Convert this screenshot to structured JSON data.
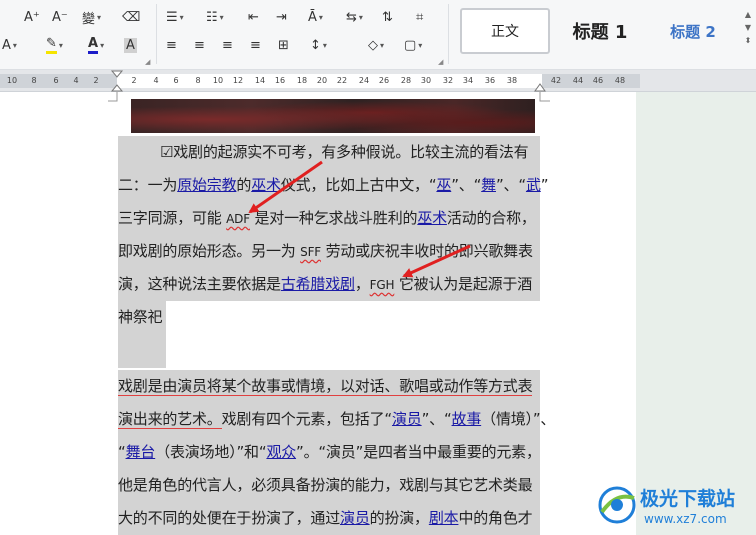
{
  "ribbon": {
    "row1": [
      {
        "name": "font-size-increase-button",
        "glyph": "A⁺"
      },
      {
        "name": "font-size-decrease-button",
        "glyph": "A⁻"
      },
      {
        "name": "phonetic-guide-button",
        "glyph": "變"
      },
      {
        "name": "clear-format-button",
        "glyph": "⌫"
      },
      {
        "name": "bullets-button",
        "glyph": "☰"
      },
      {
        "name": "numbering-button",
        "glyph": "☷"
      },
      {
        "name": "decrease-indent-button",
        "glyph": "⇤"
      },
      {
        "name": "increase-indent-button",
        "glyph": "⇥"
      },
      {
        "name": "text-direction-button",
        "glyph": "Ā"
      },
      {
        "name": "line-direction-button",
        "glyph": "⇆"
      },
      {
        "name": "sort-button",
        "glyph": "⇅"
      },
      {
        "name": "show-marks-button",
        "glyph": "⌗"
      }
    ],
    "row2": [
      {
        "name": "text-effect-button",
        "glyph": "A"
      },
      {
        "name": "highlight-color-button",
        "glyph": "✎"
      },
      {
        "name": "font-color-button",
        "glyph": "A"
      },
      {
        "name": "char-shading-button",
        "glyph": "A"
      },
      {
        "name": "align-left-button",
        "glyph": "≡"
      },
      {
        "name": "align-center-button",
        "glyph": "≡"
      },
      {
        "name": "align-right-button",
        "glyph": "≡"
      },
      {
        "name": "justify-button",
        "glyph": "≡"
      },
      {
        "name": "distributed-button",
        "glyph": "⊞"
      },
      {
        "name": "line-spacing-button",
        "glyph": "↕"
      },
      {
        "name": "shading-button",
        "glyph": "◇"
      },
      {
        "name": "borders-button",
        "glyph": "▢"
      }
    ],
    "colors": {
      "highlight": "#f5e400",
      "font_color": "#1c1cc8",
      "accent": "#3d74c6"
    }
  },
  "styles": {
    "normal": "正文",
    "heading1": "标题 1",
    "heading2": "标题 2",
    "more_up": "▲",
    "more_down": "▼",
    "expand": "⬍"
  },
  "ruler": {
    "labels": [
      "10",
      "8",
      "6",
      "4",
      "2",
      "2",
      "4",
      "6",
      "8",
      "10",
      "12",
      "14",
      "16",
      "18",
      "20",
      "22",
      "24",
      "26",
      "28",
      "30",
      "32",
      "34",
      "36",
      "38",
      "42",
      "44",
      "46",
      "48"
    ]
  },
  "document": {
    "p1": {
      "l1": [
        "☑戏剧的起源实不可考，有多种假说。比较主流的看法有"
      ],
      "l2": [
        "二：一为",
        "原始宗教",
        "的",
        "巫术",
        "仪式，比如上古中文，“",
        "巫",
        "”、“",
        "舞",
        "”、“",
        "武",
        "”"
      ],
      "l3": [
        "三字同源，可能 ",
        "ADF",
        " 是对一种乞求战斗胜利的",
        "巫术",
        "活动的合称，"
      ],
      "l4": [
        "即戏剧的原始形态。另一为 ",
        "SFF",
        " 劳动或庆祝丰收时的即兴歌舞表"
      ],
      "l5": [
        "演，这种说法主要依据是",
        "古希腊戏剧",
        "，",
        "FGH",
        " 它被认为是起源于酒"
      ],
      "l6": [
        "神祭祀"
      ]
    },
    "p2": {
      "l1": [
        "戏剧是由演员将某个故事或情境，以对话、歌唱或动作等方式表"
      ],
      "l2": [
        "演出来的艺术。",
        "戏剧有四个元素，包括了“",
        "演员",
        "”、“",
        "故事",
        "（情境）”、"
      ],
      "l3": [
        "“",
        "舞台",
        "（表演场地）”和“",
        "观众",
        "”。“演员”是四者当中最重要的元素，"
      ],
      "l4": [
        "他是角色的代言人，必须具备扮演的能力，戏剧与其它艺术类最"
      ],
      "l5": [
        "大的不同的处便在于扮演了，通过",
        "演员",
        "的扮演，",
        "剧本",
        "中的角色才"
      ]
    }
  },
  "watermark": {
    "title": "极光下载站",
    "url": "www.xz7.com"
  }
}
